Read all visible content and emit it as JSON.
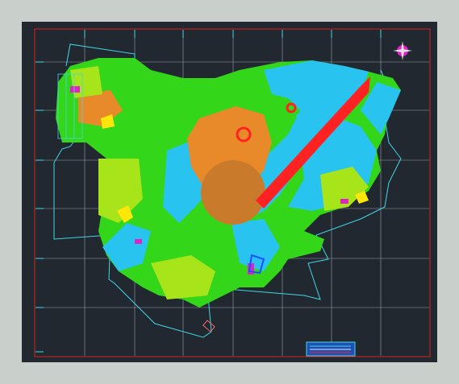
{
  "colors": {
    "background": "#212830",
    "frame": "#d62020",
    "grid": "#dfe4e6",
    "boundary": "#41d7e8",
    "road_axis": "#ff2222",
    "zone_cyan": "#29c3f0",
    "zone_green": "#34d61a",
    "zone_lime": "#a8e41a",
    "zone_orange": "#e8892a",
    "zone_yellow": "#ffe60a",
    "zone_magenta": "#e023c7",
    "zone_blue": "#1b50ff"
  },
  "icons": {
    "north_arrow": "compass-rose-icon",
    "legend": "legend-box"
  }
}
